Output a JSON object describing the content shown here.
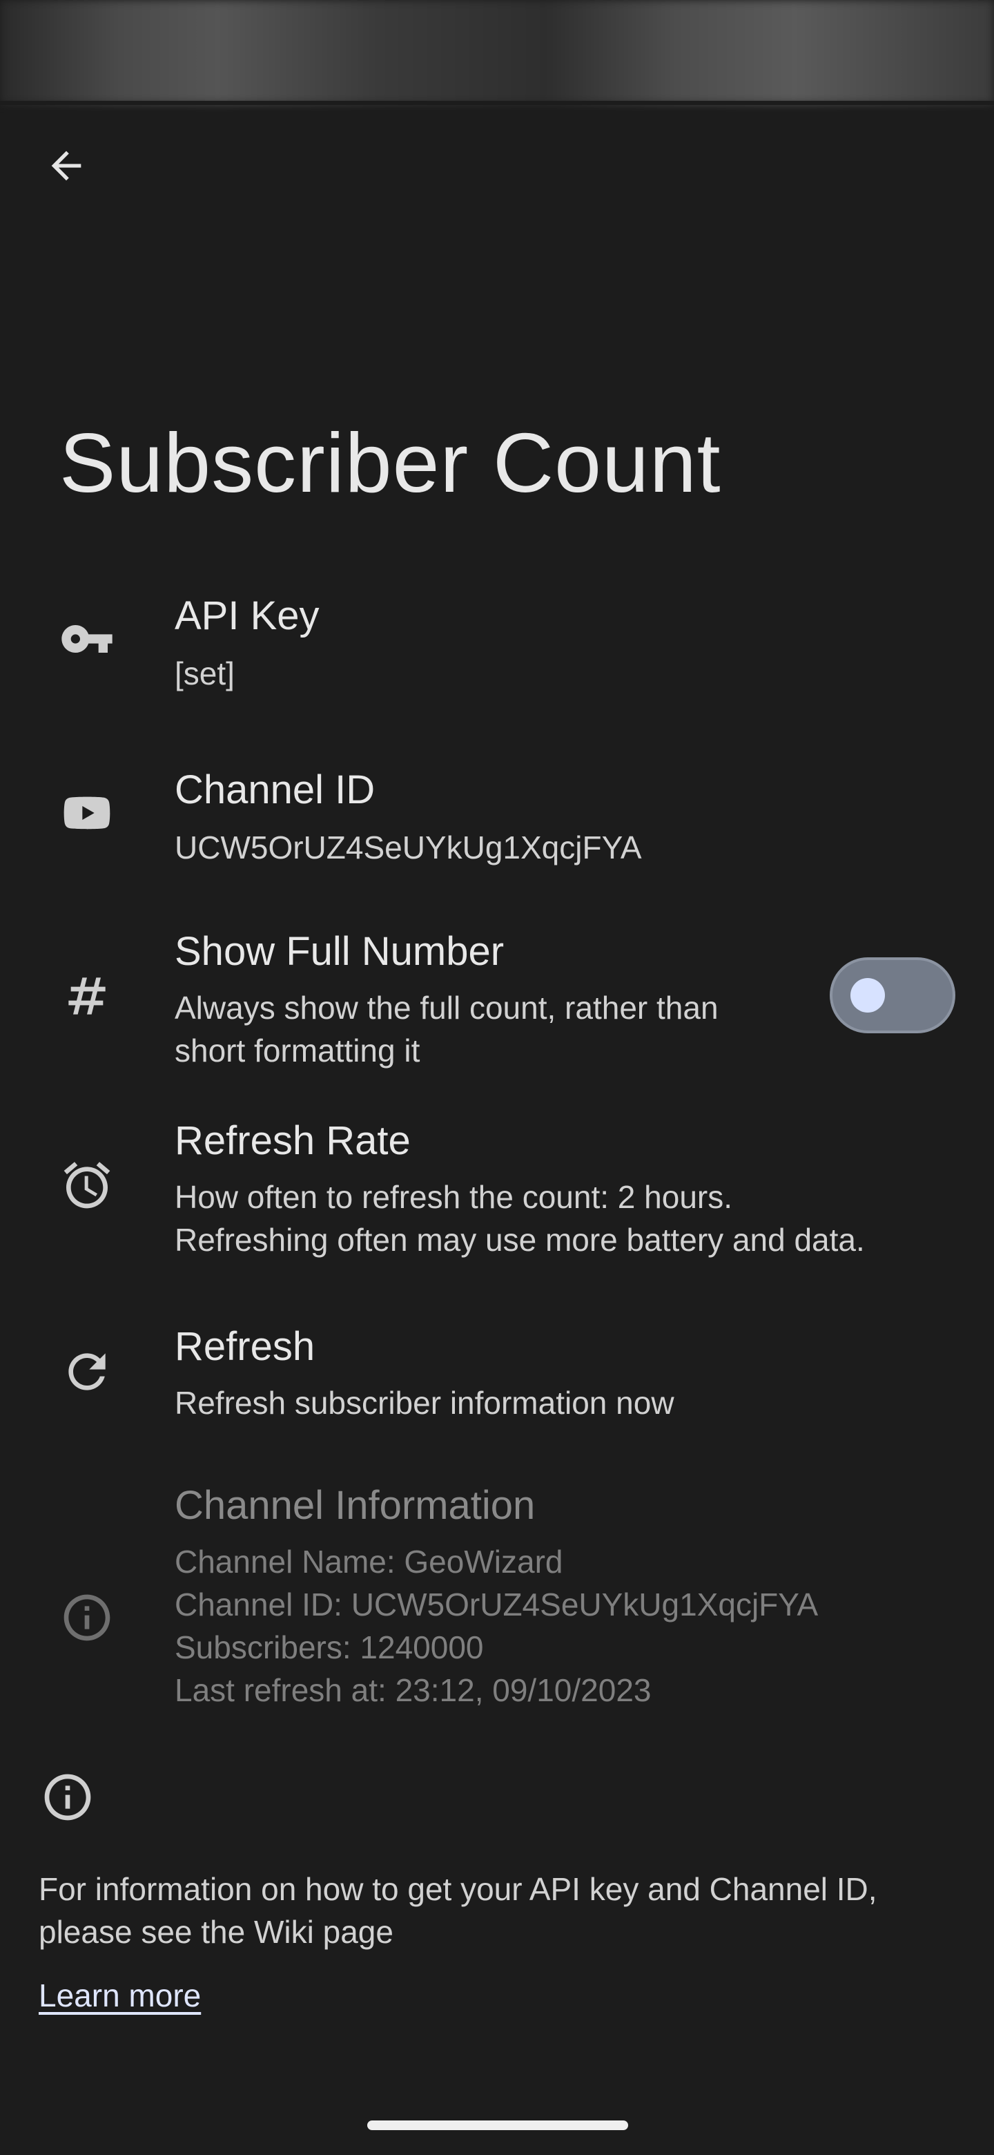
{
  "header": {
    "title": "Subscriber Count",
    "back_icon": "arrow-back-icon"
  },
  "preferences": [
    {
      "icon": "key-icon",
      "title": "API Key",
      "summary": "[set]"
    },
    {
      "icon": "youtube-icon",
      "title": "Channel ID",
      "summary": "UCW5OrUZ4SeUYkUg1XqcjFYA"
    },
    {
      "icon": "hash-icon",
      "title": "Show Full Number",
      "summary": "Always show the full count, rather than\nshort formatting it",
      "toggle_on": false
    },
    {
      "icon": "alarm-icon",
      "title": "Refresh Rate",
      "summary": "How often to refresh the count: 2 hours.\nRefreshing often may use more battery and data."
    },
    {
      "icon": "refresh-icon",
      "title": "Refresh",
      "summary": "Refresh subscriber information now"
    },
    {
      "icon": "info-icon",
      "title": "Channel Information",
      "summary": "Channel Name: GeoWizard\nChannel ID: UCW5OrUZ4SeUYkUg1XqcjFYA\nSubscribers: 1240000\nLast refresh at: 23:12, 09/10/2023",
      "disabled": true
    }
  ],
  "footer": {
    "icon": "info-icon",
    "text": "For information on how to get your API key and Channel ID, please see the Wiki page",
    "link_label": "Learn more"
  },
  "colors": {
    "background": "#1c1c1c",
    "toggle_track": "#737b89",
    "toggle_thumb": "#d7e2ff",
    "link": "#dfe6ff"
  }
}
